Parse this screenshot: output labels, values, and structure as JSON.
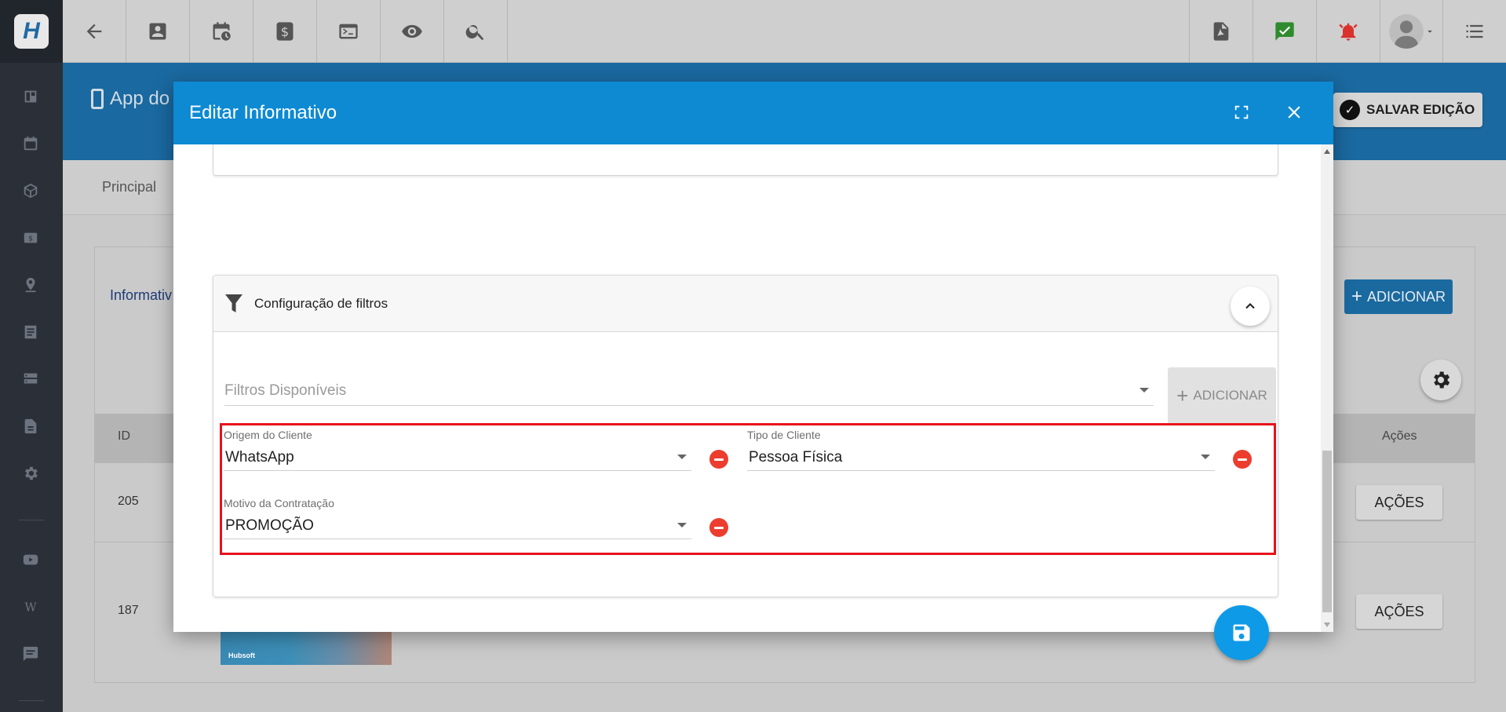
{
  "topbar": {
    "logo_letter": "H",
    "icons": [
      "back-arrow-icon",
      "contact-icon",
      "calendar-clock-icon",
      "dollar-icon",
      "terminal-icon",
      "eye-icon",
      "search-icon"
    ],
    "right_icons": [
      "pdf-icon",
      "check-message-icon",
      "alarm-icon",
      "avatar",
      "list-menu-icon"
    ]
  },
  "app": {
    "page_title": "App do",
    "save_edit_label": "SALVAR EDIÇÃO",
    "tab_principal": "Principal",
    "card_title": "Informativ",
    "add_label": "ADICIONAR",
    "table": {
      "header_id": "ID",
      "header_actions": "Ações",
      "rows": [
        {
          "id": "205",
          "actions": "AÇÕES"
        },
        {
          "id": "187",
          "actions": "AÇÕES"
        }
      ],
      "thumb_brand": "Hubsoft"
    }
  },
  "modal": {
    "title": "Editar Informativo",
    "filter_section": {
      "title": "Configuração de filtros",
      "available_placeholder": "Filtros Disponíveis",
      "add_button": "ADICIONAR",
      "filters": [
        {
          "label": "Origem do Cliente",
          "value": "WhatsApp"
        },
        {
          "label": "Tipo de Cliente",
          "value": "Pessoa Física"
        },
        {
          "label": "Motivo da Contratação",
          "value": "PROMOÇÃO"
        }
      ]
    }
  },
  "colors": {
    "modal_header": "#0e8ad3",
    "highlight": "#e8111c",
    "remove": "#ec3d2f",
    "fab": "#0e9ae6"
  }
}
